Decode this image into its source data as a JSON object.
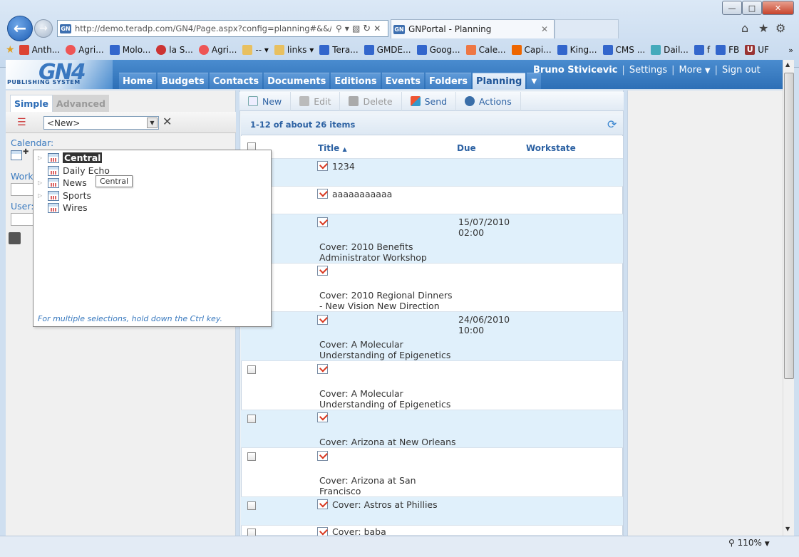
{
  "browser": {
    "address": "http://demo.teradp.com/GN4/Page.aspx?config=planning#&&/wE",
    "tab_title": "GNPortal - Planning",
    "favorites": [
      "Anth...",
      "Agri...",
      "Molo...",
      "la S...",
      "Agri...",
      "--",
      "links",
      "Tera...",
      "GMDE...",
      "Goog...",
      "Cale...",
      "Capi...",
      "King...",
      "CMS ...",
      "Dail...",
      "f",
      "FB",
      "UF"
    ],
    "zoom": "110%"
  },
  "app": {
    "logo_main": "GN4",
    "logo_sub": "PUBLISHING SYSTEM",
    "nav_tabs": [
      "Home",
      "Budgets",
      "Contacts",
      "Documents",
      "Editions",
      "Events",
      "Folders",
      "Planning"
    ],
    "user": "Bruno Stivicevic",
    "settings": "Settings",
    "more": "More",
    "signout": "Sign out"
  },
  "left": {
    "tab_simple": "Simple",
    "tab_advanced": "Advanced",
    "query_value": "<New>",
    "calendar_label": "Calendar:",
    "workstate_label": "Work",
    "user_label": "User:"
  },
  "tree": {
    "items": [
      "Central",
      "Daily Echo",
      "News",
      "Sports",
      "Wires"
    ],
    "tooltip": "Central",
    "hint": "For multiple selections, hold down the Ctrl key."
  },
  "toolbar": {
    "new": "New",
    "edit": "Edit",
    "delete": "Delete",
    "send": "Send",
    "actions": "Actions"
  },
  "grid": {
    "count": "1-12 of about 26 items",
    "col_title": "Title",
    "col_due": "Due",
    "col_workstate": "Workstate",
    "rows": [
      {
        "title": "1234",
        "due": "",
        "cover": ""
      },
      {
        "title": "aaaaaaaaaaa",
        "due": "",
        "cover": ""
      },
      {
        "title": "",
        "due": "15/07/2010 02:00",
        "cover": "Cover: 2010 Benefits Administrator Workshop"
      },
      {
        "title": "",
        "due": "",
        "cover": "Cover: 2010 Regional Dinners - New Vision New Direction"
      },
      {
        "title": "",
        "due": "24/06/2010 10:00",
        "cover": "Cover: A Molecular Understanding of Epigenetics"
      },
      {
        "title": "",
        "due": "",
        "cover": "Cover: A Molecular Understanding of Epigenetics"
      },
      {
        "title": "",
        "due": "",
        "cover": "Cover: Arizona at New Orleans"
      },
      {
        "title": "",
        "due": "",
        "cover": "Cover: Arizona at San Francisco"
      },
      {
        "title": "Cover: Astros at Phillies",
        "due": "",
        "cover": ""
      },
      {
        "title": "Cover: baba",
        "due": "",
        "cover": ""
      }
    ]
  }
}
